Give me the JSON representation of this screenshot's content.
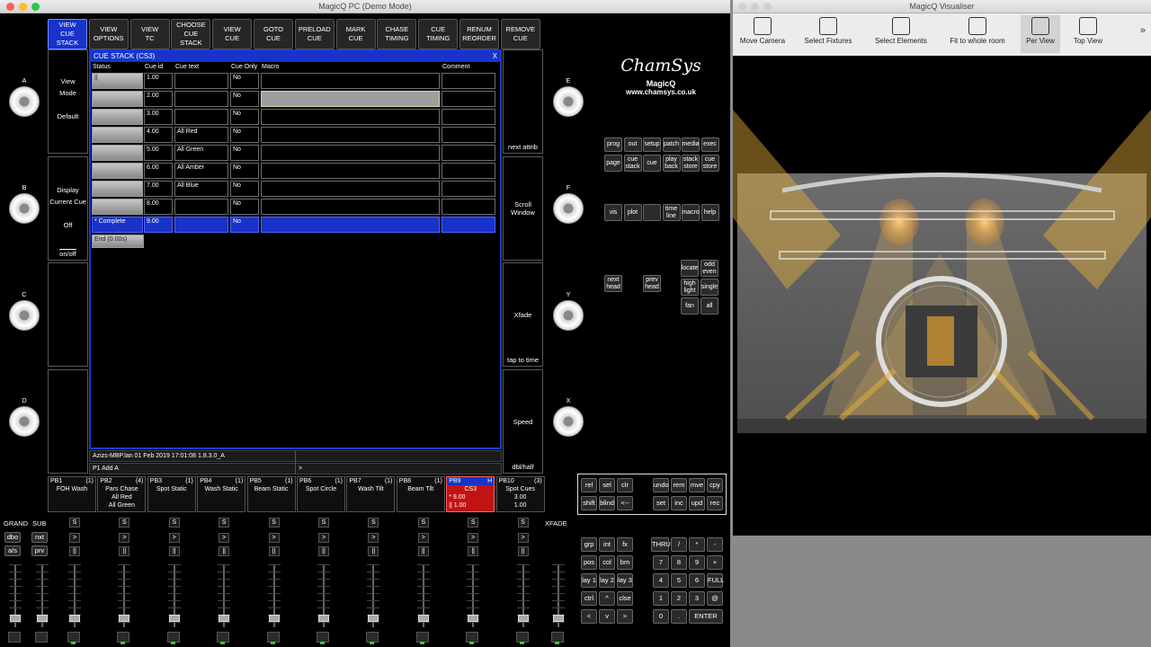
{
  "main_window": {
    "title": "MagicQ PC (Demo Mode)"
  },
  "top_buttons": [
    {
      "label": "VIEW\nCUE STACK",
      "active": true
    },
    {
      "label": "VIEW\nOPTIONS"
    },
    {
      "label": "VIEW\nTC"
    },
    {
      "label": "CHOOSE\nCUE STACK"
    },
    {
      "label": "VIEW\nCUE"
    },
    {
      "label": "GOTO\nCUE"
    },
    {
      "label": "PRELOAD\nCUE"
    },
    {
      "label": "MARK\nCUE"
    },
    {
      "label": "CHASE\nTIMING"
    },
    {
      "label": "CUE\nTIMING"
    },
    {
      "label": "RENUM\nREORDER"
    },
    {
      "label": "REMOVE\nCUE"
    }
  ],
  "left_boxes": [
    {
      "lines": [
        "View",
        "Mode",
        "",
        "Default"
      ]
    },
    {
      "lines": [
        "Display",
        "Current Cue",
        "",
        "Off"
      ],
      "sub": "on/off"
    },
    {
      "lines": []
    },
    {
      "lines": []
    }
  ],
  "left_knobs": [
    "A",
    "B",
    "C",
    "D"
  ],
  "right_knobs": [
    "E",
    "F",
    "Y",
    "X"
  ],
  "right_boxes": [
    {
      "label": "",
      "sub": "next attrib"
    },
    {
      "label": "Scroll\nWindow",
      "sub": ""
    },
    {
      "label": "Xfade",
      "sub": "tap to time"
    },
    {
      "label": "Speed",
      "sub": "dbl/half"
    }
  ],
  "cue_stack": {
    "title": "CUE STACK (CS3)",
    "close": "X",
    "columns": [
      "Status",
      "Cue id",
      "Cue text",
      "Cue Only",
      "Macro",
      "Comment"
    ],
    "rows": [
      {
        "status": "||",
        "id": "1.00",
        "text": "",
        "only": "No"
      },
      {
        "status": "",
        "id": "2.00",
        "text": "",
        "only": "No"
      },
      {
        "status": "",
        "id": "3.00",
        "text": "",
        "only": "No"
      },
      {
        "status": "",
        "id": "4.00",
        "text": "All Red",
        "only": "No"
      },
      {
        "status": "",
        "id": "5.00",
        "text": "All Green",
        "only": "No"
      },
      {
        "status": "",
        "id": "6.00",
        "text": "All Amber",
        "only": "No"
      },
      {
        "status": "",
        "id": "7.00",
        "text": "All Blue",
        "only": "No"
      },
      {
        "status": "",
        "id": "8.00",
        "text": "",
        "only": "No"
      },
      {
        "status": "*  Complete",
        "id": "9.00",
        "text": "",
        "only": "No"
      }
    ],
    "end_label": "End (0.00s)",
    "status_line": "Azizs-MBP.lan 01 Feb 2019 17:01:08 1.8.3.0_A",
    "cmd_line": "P1  Add A",
    "prompt": ">"
  },
  "logo": {
    "brand": "ChamSys",
    "product": "MagicQ",
    "url": "www.chamsys.co.uk"
  },
  "keys_top": [
    [
      "prog",
      "out",
      "setup",
      "patch",
      "media",
      "exec"
    ],
    [
      "page",
      "cue stack",
      "cue",
      "play back",
      "stack store",
      "cue store"
    ],
    [
      "vis",
      "plot",
      "",
      "time line",
      "macro",
      "help"
    ]
  ],
  "keys_mid": [
    "next head",
    "prev head",
    "locate",
    "odd even",
    "high light",
    "single",
    "fan",
    "all"
  ],
  "keys_box": [
    [
      "rel",
      "sel",
      "clr",
      "undo",
      "rem",
      "mve",
      "cpy"
    ],
    [
      "shift",
      "blind",
      "<--",
      "set",
      "inc",
      "upd",
      "rec"
    ]
  ],
  "keys_left": [
    [
      "grp",
      "int",
      "fx"
    ],
    [
      "pos",
      "col",
      "bm"
    ],
    [
      "lay 1",
      "lay 2",
      "lay 3"
    ],
    [
      "ctrl",
      "^",
      "clse"
    ],
    [
      "<",
      "v",
      ">"
    ]
  ],
  "keys_num": [
    [
      "THRU",
      "/",
      "*",
      "-"
    ],
    [
      "7",
      "8",
      "9",
      "+"
    ],
    [
      "4",
      "5",
      "6",
      "FULL"
    ],
    [
      "1",
      "2",
      "3",
      "@"
    ],
    [
      "0",
      ".",
      "ENTER"
    ]
  ],
  "playbacks": [
    {
      "name": "PB1",
      "count": "(1)",
      "label": "FOH Wash"
    },
    {
      "name": "PB2",
      "count": "(4)",
      "label": "Pars Chase",
      "extra": [
        "All Red",
        "All Green"
      ]
    },
    {
      "name": "PB3",
      "count": "(1)",
      "label": "Spot Static"
    },
    {
      "name": "PB4",
      "count": "(1)",
      "label": "Wash Static"
    },
    {
      "name": "PB5",
      "count": "(1)",
      "label": "Beam Static"
    },
    {
      "name": "PB6",
      "count": "(1)",
      "label": "Spot Circle"
    },
    {
      "name": "PB7",
      "count": "(1)",
      "label": "Wash Tilt"
    },
    {
      "name": "PB8",
      "count": "(1)",
      "label": "Beam Tilt"
    },
    {
      "name": "PB9",
      "count": "H",
      "label": "CS3",
      "extra": [
        "*  9.00",
        "|| 1.00"
      ],
      "active": true
    },
    {
      "name": "PB10",
      "count": "(3)",
      "label": "Spot Cues",
      "extra": [
        "3.00",
        "1.00"
      ]
    }
  ],
  "fader_labels": {
    "grand": "GRAND",
    "sub": "SUB",
    "xfade": "XFADE",
    "dbo": "dbo",
    "nxt": "nxt",
    "as": "a/s",
    "prv": "prv"
  },
  "visualiser": {
    "title": "MagicQ Visualiser",
    "tools": [
      "Move Camera",
      "Select Fixtures",
      "Select Elements",
      "Fit to whole room",
      "Per View",
      "Top View"
    ],
    "active_tool": "Per View",
    "more": "»"
  }
}
